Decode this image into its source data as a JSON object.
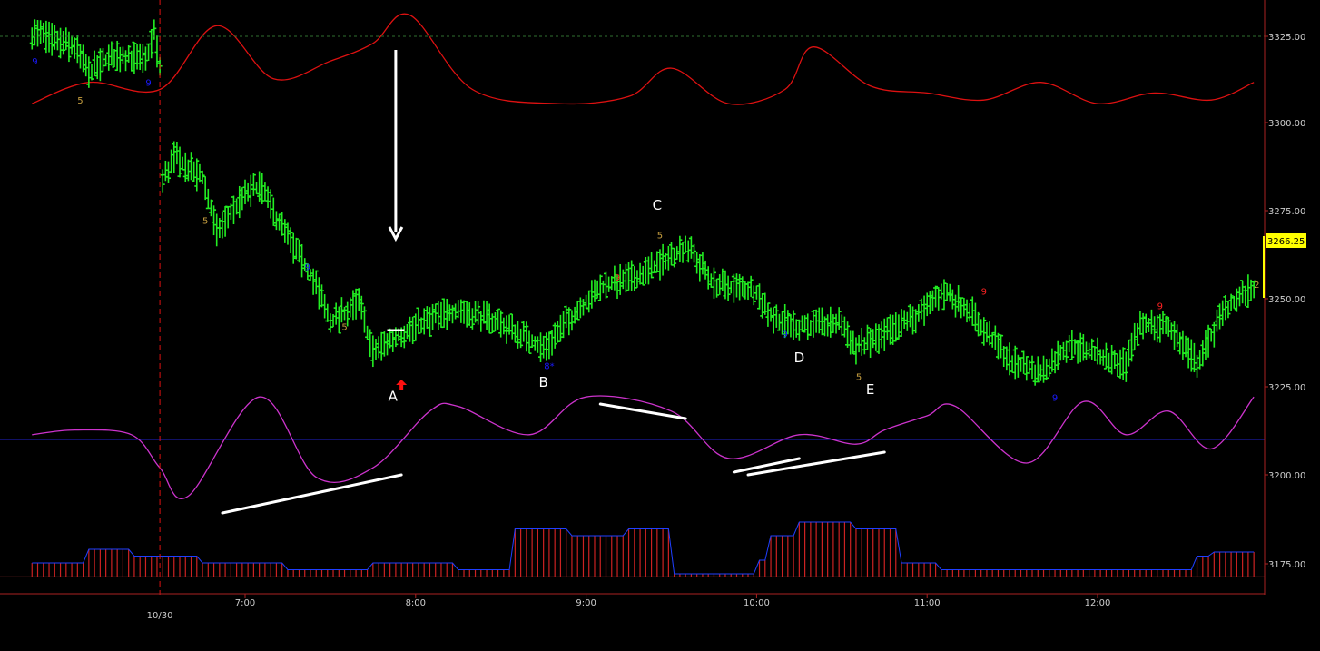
{
  "colors": {
    "background": "#000000",
    "price_bars": "#22ee22",
    "band_line": "#dd1111",
    "oscillator": "#cc33cc",
    "zero_line": "#2222cc",
    "histogram": "#cc2222",
    "histogram_outline": "#1f3fff",
    "axis_text": "#cccccc",
    "annotation": "#ffffff",
    "last_price_box": "#ffff00",
    "count_5": "#c8a040",
    "count_9_blue": "#1a1aff",
    "count_9_red": "#ff2222"
  },
  "chart_data": {
    "type": "bar",
    "price_axis": {
      "ticks": [
        3325,
        3300,
        3275,
        3250,
        3225,
        3200,
        3175
      ],
      "tick_labels": [
        "3325.00",
        "3300.00",
        "3275.00",
        "3250.00",
        "3225.00",
        "3200.00",
        "3175.00"
      ],
      "reference_level": 3325
    },
    "time_axis": {
      "ticks": [
        "7:00",
        "8:00",
        "9:00",
        "10:00",
        "11:00",
        "12:00"
      ],
      "date_label": "10/30",
      "session_start": "6:30"
    },
    "last_price": "3266.25",
    "ohlc_path": [
      [
        "5:45",
        3326
      ],
      [
        "6:00",
        3322
      ],
      [
        "6:05",
        3315
      ],
      [
        "6:15",
        3320
      ],
      [
        "6:25",
        3318
      ],
      [
        "6:28",
        3326
      ],
      [
        "6:30",
        3316
      ],
      [
        "6:31",
        3284
      ],
      [
        "6:35",
        3291
      ],
      [
        "6:45",
        3285
      ],
      [
        "6:50",
        3270
      ],
      [
        "7:00",
        3280
      ],
      [
        "7:05",
        3283
      ],
      [
        "7:15",
        3268
      ],
      [
        "7:25",
        3255
      ],
      [
        "7:30",
        3244
      ],
      [
        "7:40",
        3250
      ],
      [
        "7:45",
        3236
      ],
      [
        "7:55",
        3241
      ],
      [
        "8:05",
        3245
      ],
      [
        "8:15",
        3248
      ],
      [
        "8:30",
        3244
      ],
      [
        "8:45",
        3237
      ],
      [
        "8:55",
        3246
      ],
      [
        "9:05",
        3254
      ],
      [
        "9:20",
        3258
      ],
      [
        "9:30",
        3263
      ],
      [
        "9:35",
        3266
      ],
      [
        "9:45",
        3255
      ],
      [
        "10:00",
        3253
      ],
      [
        "10:05",
        3246
      ],
      [
        "10:15",
        3243
      ],
      [
        "10:30",
        3244
      ],
      [
        "10:35",
        3237
      ],
      [
        "10:50",
        3243
      ],
      [
        "11:00",
        3248
      ],
      [
        "11:05",
        3253
      ],
      [
        "11:15",
        3248
      ],
      [
        "11:20",
        3242
      ],
      [
        "11:30",
        3233
      ],
      [
        "11:40",
        3230
      ],
      [
        "11:50",
        3238
      ],
      [
        "12:10",
        3232
      ],
      [
        "12:15",
        3244
      ],
      [
        "12:25",
        3243
      ],
      [
        "12:35",
        3233
      ],
      [
        "12:45",
        3248
      ],
      [
        "12:55",
        3254
      ]
    ],
    "band_path": [
      [
        "5:45",
        3306
      ],
      [
        "6:05",
        3312
      ],
      [
        "6:30",
        3310
      ],
      [
        "6:50",
        3328
      ],
      [
        "7:10",
        3313
      ],
      [
        "7:30",
        3318
      ],
      [
        "7:45",
        3323
      ],
      [
        "7:58",
        3331
      ],
      [
        "8:20",
        3310
      ],
      [
        "8:50",
        3306
      ],
      [
        "9:15",
        3308
      ],
      [
        "9:30",
        3316
      ],
      [
        "9:50",
        3306
      ],
      [
        "10:10",
        3310
      ],
      [
        "10:20",
        3322
      ],
      [
        "10:40",
        3311
      ],
      [
        "11:00",
        3309
      ],
      [
        "11:20",
        3307
      ],
      [
        "11:40",
        3312
      ],
      [
        "12:00",
        3306
      ],
      [
        "12:20",
        3309
      ],
      [
        "12:40",
        3307
      ],
      [
        "12:55",
        3312
      ]
    ],
    "oscillator_path": [
      [
        "5:45",
        0.1
      ],
      [
        "6:00",
        0.2
      ],
      [
        "6:20",
        0.1
      ],
      [
        "6:30",
        -0.6
      ],
      [
        "6:40",
        -1.2
      ],
      [
        "7:05",
        0.9
      ],
      [
        "7:25",
        -0.8
      ],
      [
        "7:45",
        -0.6
      ],
      [
        "8:05",
        0.6
      ],
      [
        "8:15",
        0.7
      ],
      [
        "8:40",
        0.1
      ],
      [
        "9:00",
        0.9
      ],
      [
        "9:30",
        0.6
      ],
      [
        "9:50",
        -0.4
      ],
      [
        "10:15",
        0.1
      ],
      [
        "10:35",
        -0.1
      ],
      [
        "10:45",
        0.2
      ],
      [
        "11:00",
        0.5
      ],
      [
        "11:10",
        0.7
      ],
      [
        "11:35",
        -0.5
      ],
      [
        "11:55",
        0.8
      ],
      [
        "12:10",
        0.1
      ],
      [
        "12:25",
        0.6
      ],
      [
        "12:40",
        -0.2
      ],
      [
        "12:55",
        0.9
      ]
    ],
    "histogram_levels": [
      [
        "5:45",
        1
      ],
      [
        "6:05",
        2
      ],
      [
        "6:20",
        1.5
      ],
      [
        "6:45",
        1
      ],
      [
        "7:15",
        0.5
      ],
      [
        "7:45",
        1
      ],
      [
        "8:15",
        0.5
      ],
      [
        "8:35",
        3.5
      ],
      [
        "8:55",
        3
      ],
      [
        "9:15",
        3.5
      ],
      [
        "9:30",
        0.2
      ],
      [
        "10:00",
        1.2
      ],
      [
        "10:05",
        3
      ],
      [
        "10:15",
        4
      ],
      [
        "10:35",
        3.5
      ],
      [
        "10:50",
        1
      ],
      [
        "11:05",
        0.5
      ],
      [
        "12:35",
        1.5
      ],
      [
        "12:40",
        1.8
      ]
    ],
    "count_labels": [
      {
        "time": "6:02",
        "price": 3306,
        "text": "5",
        "color_key": "count_5"
      },
      {
        "time": "5:46",
        "price": 3317,
        "text": "9",
        "color_key": "count_9_blue"
      },
      {
        "time": "6:26",
        "price": 3311,
        "text": "9",
        "color_key": "count_9_blue"
      },
      {
        "time": "6:46",
        "price": 3272,
        "text": "5",
        "color_key": "count_5"
      },
      {
        "time": "7:22",
        "price": 3259,
        "text": "9",
        "color_key": "count_9_blue"
      },
      {
        "time": "7:35",
        "price": 3242,
        "text": "5",
        "color_key": "count_5"
      },
      {
        "time": "8:47",
        "price": 3231,
        "text": "8*",
        "color_key": "count_9_blue"
      },
      {
        "time": "9:11",
        "price": 3256,
        "text": "9",
        "color_key": "count_9_red"
      },
      {
        "time": "9:26",
        "price": 3268,
        "text": "5",
        "color_key": "count_5"
      },
      {
        "time": "10:10",
        "price": 3240,
        "text": "9",
        "color_key": "count_9_blue"
      },
      {
        "time": "10:36",
        "price": 3228,
        "text": "5",
        "color_key": "count_5"
      },
      {
        "time": "11:20",
        "price": 3252,
        "text": "9",
        "color_key": "count_9_red"
      },
      {
        "time": "11:45",
        "price": 3222,
        "text": "9",
        "color_key": "count_9_blue"
      },
      {
        "time": "12:22",
        "price": 3248,
        "text": "9",
        "color_key": "count_9_red"
      },
      {
        "time": "12:56",
        "price": 3254,
        "text": "2",
        "color_key": "count_5"
      }
    ],
    "annotations": [
      {
        "time": "7:52",
        "price": 3222,
        "text": "A"
      },
      {
        "time": "8:45",
        "price": 3226,
        "text": "B"
      },
      {
        "time": "9:25",
        "price": 3276,
        "text": "C"
      },
      {
        "time": "10:15",
        "price": 3233,
        "text": "D"
      },
      {
        "time": "10:40",
        "price": 3224,
        "text": "E"
      }
    ]
  }
}
